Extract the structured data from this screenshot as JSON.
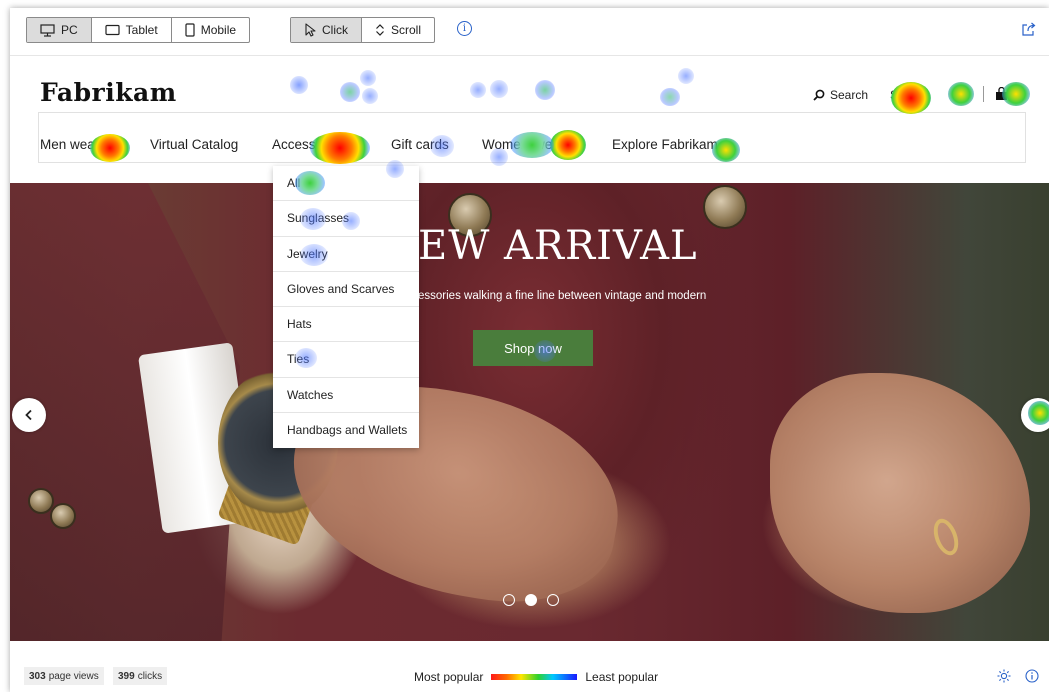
{
  "toolbar": {
    "devices": [
      {
        "label": "PC",
        "icon": "monitor-icon",
        "active": true
      },
      {
        "label": "Tablet",
        "icon": "tablet-icon",
        "active": false
      },
      {
        "label": "Mobile",
        "icon": "mobile-icon",
        "active": false
      }
    ],
    "modes": [
      {
        "label": "Click",
        "icon": "pointer-icon",
        "active": true
      },
      {
        "label": "Scroll",
        "icon": "scroll-icon",
        "active": false
      }
    ],
    "info_glyph": "i",
    "accent_color": "#2a62c9"
  },
  "site": {
    "logo": "Fabrikam",
    "search_label": "Search",
    "signin_label": "S",
    "nav": [
      "Men wear",
      "Virtual Catalog",
      "Accessories",
      "Gift cards",
      "Womenswear",
      "Explore Fabrikam"
    ],
    "dropdown": [
      "All",
      "Sunglasses",
      "Jewelry",
      "Gloves and Scarves",
      "Hats",
      "Ties",
      "Watches",
      "Handbags and Wallets"
    ]
  },
  "hero": {
    "title": "EW ARRIVAL",
    "subtitle": "essories walking a fine line between vintage and modern",
    "cta": "Shop now",
    "cta_color": "#4a7d3c",
    "slide_count": 3,
    "active_slide": 2
  },
  "footer": {
    "page_views_value": "303",
    "page_views_label": "page views",
    "clicks_value": "399",
    "clicks_label": "clicks",
    "legend_most": "Most popular",
    "legend_least": "Least popular"
  }
}
